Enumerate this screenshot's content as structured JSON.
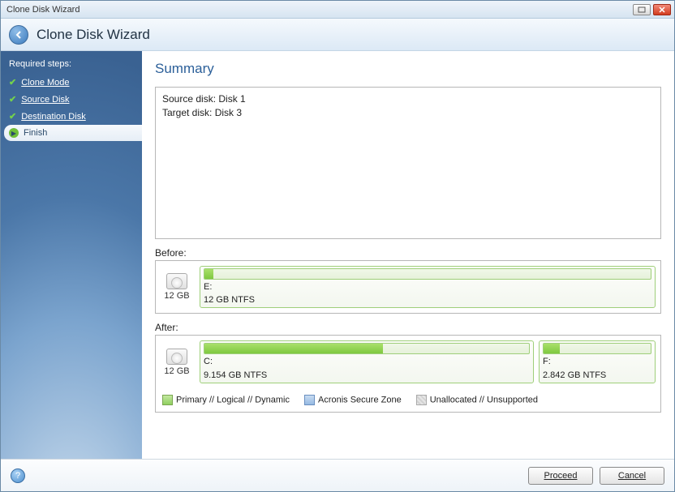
{
  "window": {
    "title": "Clone Disk Wizard"
  },
  "header": {
    "title": "Clone Disk Wizard"
  },
  "sidebar": {
    "heading": "Required steps:",
    "steps": [
      {
        "label": "Clone Mode",
        "done": true
      },
      {
        "label": "Source Disk",
        "done": true
      },
      {
        "label": "Destination Disk",
        "done": true
      },
      {
        "label": "Finish",
        "active": true
      }
    ]
  },
  "main": {
    "title": "Summary",
    "source_line": "Source disk: Disk 1",
    "target_line": "Target disk: Disk 3",
    "before_label": "Before:",
    "after_label": "After:",
    "before": {
      "disk_size": "12 GB",
      "partitions": [
        {
          "letter": "E:",
          "desc": "12 GB  NTFS",
          "fill_pct": 2,
          "flex": 1
        }
      ]
    },
    "after": {
      "disk_size": "12 GB",
      "partitions": [
        {
          "letter": "C:",
          "desc": "9.154 GB  NTFS",
          "fill_pct": 55,
          "flex": 3
        },
        {
          "letter": "F:",
          "desc": "2.842 GB  NTFS",
          "fill_pct": 15,
          "flex": 1
        }
      ]
    },
    "legend": {
      "primary": "Primary // Logical // Dynamic",
      "secure": "Acronis Secure Zone",
      "unalloc": "Unallocated // Unsupported"
    }
  },
  "footer": {
    "proceed": "Proceed",
    "cancel": "Cancel"
  }
}
